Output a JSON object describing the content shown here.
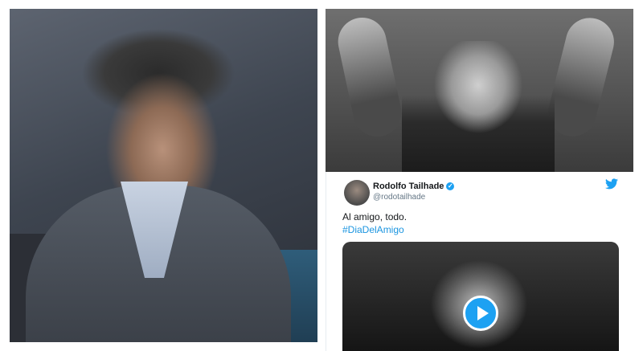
{
  "tweet": {
    "display_name": "Rodolfo Tailhade",
    "handle": "@rodotailhade",
    "text": "Al amigo, todo.",
    "hashtag": "#DiaDelAmigo"
  },
  "icons": {
    "verified": "verified-badge-icon",
    "bird": "twitter-bird-icon",
    "play": "play-icon"
  },
  "colors": {
    "twitter_blue": "#1da1f2",
    "hashtag_blue": "#1b95e0"
  }
}
